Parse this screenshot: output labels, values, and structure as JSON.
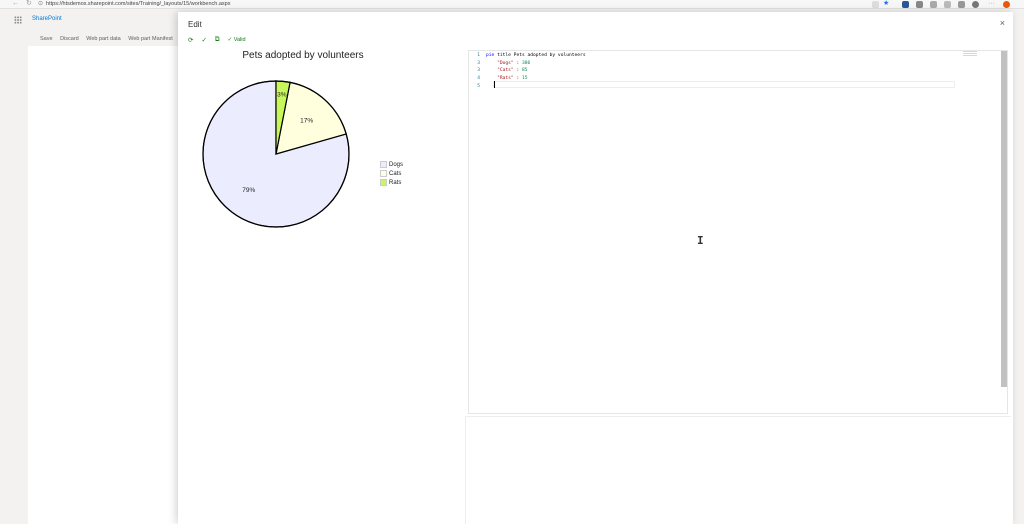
{
  "browser": {
    "url": "https://htsdemos.sharepoint.com/sites/Training/_layouts/15/workbench.aspx",
    "back_icon": "back-arrow-icon",
    "refresh_icon": "refresh-icon",
    "lock_icon": "lock-icon"
  },
  "sharepoint": {
    "brand": "SharePoint",
    "commands": [
      "Save",
      "Discard",
      "Web part data",
      "Web part Manifest"
    ]
  },
  "panel": {
    "title": "Edit",
    "close_glyph": "×",
    "valid_label": "✓ Valid"
  },
  "chart_data": {
    "type": "pie",
    "title": "Pets adopted by volunteers",
    "categories": [
      "Dogs",
      "Cats",
      "Rats"
    ],
    "values": [
      386,
      85,
      15
    ],
    "labels": [
      "79%",
      "17%",
      "3%"
    ],
    "colors": [
      "#ECECFF",
      "#FFFFDE",
      "#C7F75A"
    ],
    "legend_position": "right"
  },
  "editor": {
    "lines": [
      {
        "n": "1",
        "tokens": [
          {
            "t": "kw",
            "v": "pie "
          },
          {
            "t": "txt",
            "v": "title Pets adopted by volunteers"
          }
        ]
      },
      {
        "n": "3",
        "tokens": [
          {
            "t": "txt",
            "v": "    "
          },
          {
            "t": "str",
            "v": "\"Dogs\""
          },
          {
            "t": "txt",
            "v": " : "
          },
          {
            "t": "num",
            "v": "386"
          }
        ]
      },
      {
        "n": "3",
        "tokens": [
          {
            "t": "txt",
            "v": "    "
          },
          {
            "t": "str",
            "v": "\"Cats\""
          },
          {
            "t": "txt",
            "v": " : "
          },
          {
            "t": "num",
            "v": "85"
          }
        ]
      },
      {
        "n": "4",
        "tokens": [
          {
            "t": "txt",
            "v": "    "
          },
          {
            "t": "str",
            "v": "\"Rats\""
          },
          {
            "t": "txt",
            "v": " : "
          },
          {
            "t": "num",
            "v": "15"
          }
        ]
      },
      {
        "n": "5",
        "tokens": []
      }
    ]
  }
}
